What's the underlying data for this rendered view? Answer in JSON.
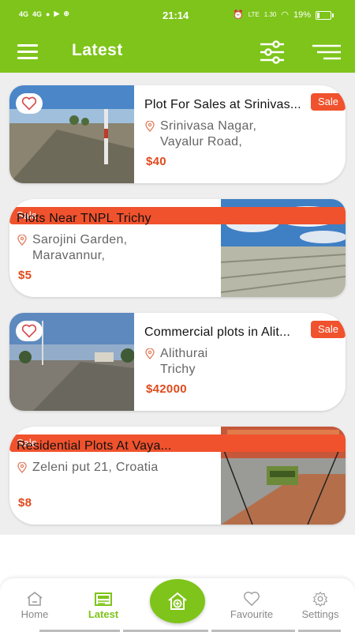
{
  "status_bar": {
    "signal_left": "4G",
    "signal_right": "4G",
    "time": "21:14",
    "net_speed": "1.30",
    "volte": "LTE",
    "battery": "19%"
  },
  "app_bar": {
    "title": "Latest"
  },
  "listings": [
    {
      "title": "Plot For Sales at Srinivas...",
      "address_line1": "Srinivasa Nagar,",
      "address_line2": "Vayalur Road,",
      "price": "$40",
      "badge": "Sale"
    },
    {
      "title": "Plots Near TNPL Trichy",
      "address_line1": "Sarojini Garden,",
      "address_line2": "Maravannur,",
      "price": "$5",
      "badge": "Sale"
    },
    {
      "title": "Commercial plots in Alit...",
      "address_line1": "Alithurai",
      "address_line2": "Trichy",
      "price": "$42000",
      "badge": "Sale"
    },
    {
      "title": "Residential Plots At Vaya...",
      "address_line1": "Zeleni put 21, Croatia",
      "address_line2": "",
      "price": "$8",
      "badge": "Sale"
    }
  ],
  "bottom_nav": {
    "home": "Home",
    "latest": "Latest",
    "favourite": "Favourite",
    "settings": "Settings"
  },
  "colors": {
    "primary": "#7ec41a",
    "sale": "#f0522d",
    "price": "#e04a1c"
  }
}
